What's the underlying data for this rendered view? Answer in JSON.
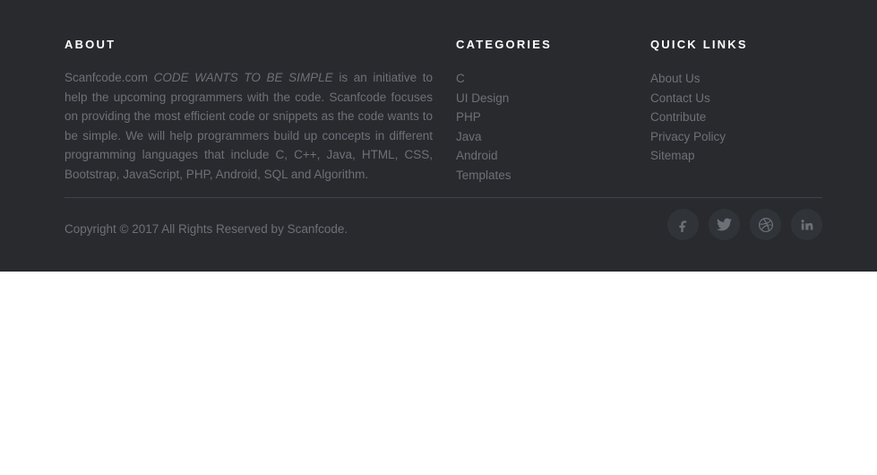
{
  "footer": {
    "background_color": "#282a2e",
    "heading_color": "#ffffff",
    "text_color": "#6d7077",
    "divider_color": "#3f4349",
    "about": {
      "heading": "ABOUT",
      "text_before": "Scanfcode.com ",
      "tagline": "CODE WANTS TO BE SIMPLE",
      "text_after": " is an initiative to help the upcoming programmers with the code. Scanfcode focuses on providing the most efficient code or snippets as the code wants to be simple. We will help programmers build up concepts in different programming languages that include C, C++, Java, HTML, CSS, Bootstrap, JavaScript, PHP, Android, SQL and Algorithm."
    },
    "categories": {
      "heading": "CATEGORIES",
      "items": [
        {
          "label": "C"
        },
        {
          "label": "UI Design"
        },
        {
          "label": "PHP"
        },
        {
          "label": "Java"
        },
        {
          "label": "Android"
        },
        {
          "label": "Templates"
        }
      ]
    },
    "quick_links": {
      "heading": "QUICK LINKS",
      "items": [
        {
          "label": "About Us"
        },
        {
          "label": "Contact Us"
        },
        {
          "label": "Contribute"
        },
        {
          "label": "Privacy Policy"
        },
        {
          "label": "Sitemap"
        }
      ]
    },
    "bottom": {
      "copyright": "Copyright © 2017 All Rights Reserved by Scanfcode.",
      "social": [
        {
          "icon": "facebook-icon",
          "name": "Facebook"
        },
        {
          "icon": "twitter-icon",
          "name": "Twitter"
        },
        {
          "icon": "dribbble-icon",
          "name": "Dribbble"
        },
        {
          "icon": "linkedin-icon",
          "name": "LinkedIn"
        }
      ]
    }
  }
}
